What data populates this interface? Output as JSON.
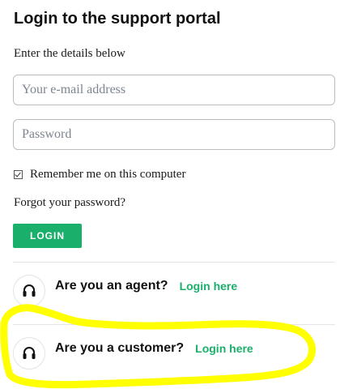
{
  "login": {
    "title": "Login to the support portal",
    "subtitle": "Enter the details below",
    "email_placeholder": "Your e-mail address",
    "password_placeholder": "Password",
    "remember_label": "Remember me on this computer",
    "remember_checked": true,
    "forgot_label": "Forgot your password?",
    "login_button": "LOGIN"
  },
  "roles": {
    "agent": {
      "icon": "headset-icon",
      "question": "Are you an agent?",
      "link": "Login here"
    },
    "customer": {
      "icon": "headset-icon",
      "question": "Are you a customer?",
      "link": "Login here"
    }
  },
  "colors": {
    "accent": "#1aaf6a",
    "highlight": "#ffff00"
  }
}
